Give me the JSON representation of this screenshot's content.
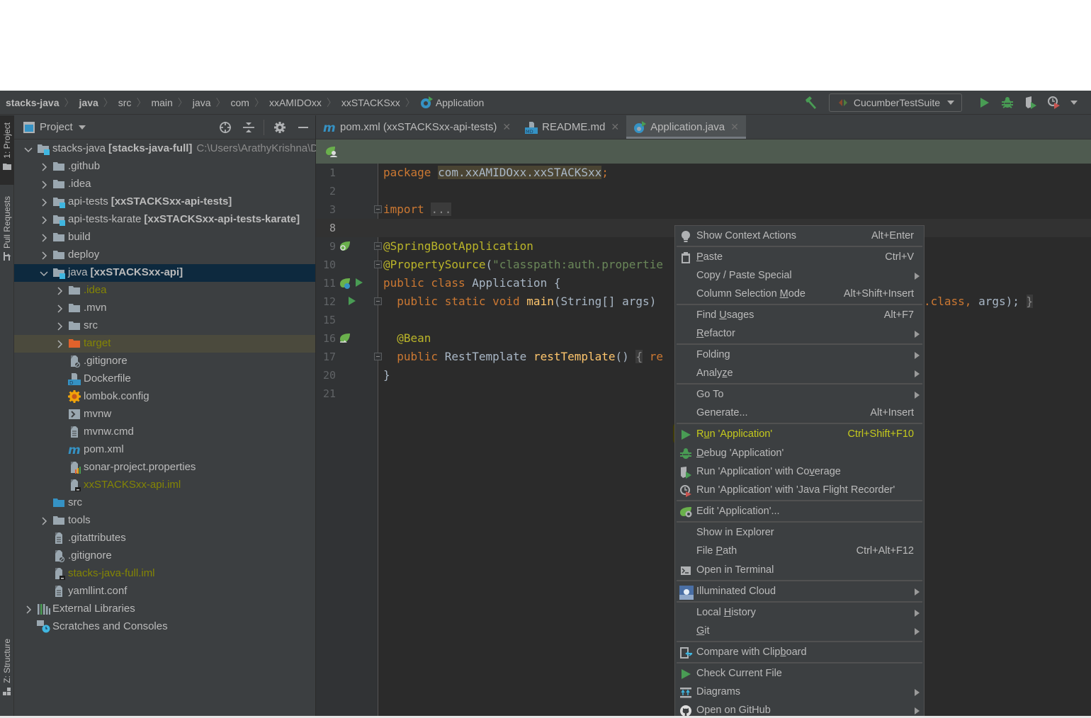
{
  "breadcrumb": {
    "items": [
      {
        "label": "stacks-java",
        "bold": true
      },
      {
        "label": "java",
        "bold": true
      },
      {
        "label": "src",
        "bold": false
      },
      {
        "label": "main",
        "bold": false
      },
      {
        "label": "java",
        "bold": false
      },
      {
        "label": "com",
        "bold": false
      },
      {
        "label": "xxAMIDOxx",
        "bold": false
      },
      {
        "label": "xxSTACKSxx",
        "bold": false
      }
    ],
    "current": "Application",
    "current_icon": "spring-class-icon"
  },
  "toolbar": {
    "build_icon": "hammer-icon",
    "run_config": "CucumberTestSuite",
    "run_icon": "run-icon",
    "debug_icon": "debug-bug-icon",
    "coverage_icon": "coverage-icon",
    "profiler_icon": "profiler-icon"
  },
  "left_strip": {
    "project_tab": "1: Project",
    "pull_requests_tab": "Pull Requests",
    "structure_tab": "Z: Structure"
  },
  "project_panel": {
    "title": "Project",
    "tree": [
      {
        "label": "stacks-java",
        "bold": "[stacks-java-full]",
        "path": "C:\\Users\\ArathyKrishna\\Do",
        "depth": 0,
        "expanded": true,
        "icon": "module-folder"
      },
      {
        "label": ".github",
        "depth": 1,
        "expanded": false,
        "icon": "folder"
      },
      {
        "label": ".idea",
        "depth": 1,
        "expanded": false,
        "icon": "folder"
      },
      {
        "label": "api-tests",
        "bold": "[xxSTACKSxx-api-tests]",
        "depth": 1,
        "expanded": false,
        "icon": "module-folder"
      },
      {
        "label": "api-tests-karate",
        "bold": "[xxSTACKSxx-api-tests-karate]",
        "depth": 1,
        "expanded": false,
        "icon": "module-folder"
      },
      {
        "label": "build",
        "depth": 1,
        "expanded": false,
        "icon": "folder"
      },
      {
        "label": "deploy",
        "depth": 1,
        "expanded": false,
        "icon": "folder"
      },
      {
        "label": "java",
        "bold": "[xxSTACKSxx-api]",
        "depth": 1,
        "expanded": true,
        "icon": "module-folder",
        "selected": true
      },
      {
        "label": ".idea",
        "depth": 2,
        "expanded": false,
        "icon": "folder",
        "ignored": true
      },
      {
        "label": ".mvn",
        "depth": 2,
        "expanded": false,
        "icon": "folder"
      },
      {
        "label": "src",
        "depth": 2,
        "expanded": false,
        "icon": "folder"
      },
      {
        "label": "target",
        "depth": 2,
        "expanded": false,
        "icon": "excluded-folder",
        "ignored": true,
        "target": true
      },
      {
        "label": ".gitignore",
        "depth": 2,
        "icon": "gitignore-file"
      },
      {
        "label": "Dockerfile",
        "depth": 2,
        "icon": "docker-file"
      },
      {
        "label": "lombok.config",
        "depth": 2,
        "icon": "lombok-config"
      },
      {
        "label": "mvnw",
        "depth": 2,
        "icon": "shell-script"
      },
      {
        "label": "mvnw.cmd",
        "depth": 2,
        "icon": "text-file"
      },
      {
        "label": "pom.xml",
        "depth": 2,
        "icon": "maven-file"
      },
      {
        "label": "sonar-project.properties",
        "depth": 2,
        "icon": "properties-file"
      },
      {
        "label": "xxSTACKSxx-api.iml",
        "depth": 2,
        "icon": "iml-file",
        "ignored": true
      },
      {
        "label": "src",
        "depth": 1,
        "icon": "source-folder"
      },
      {
        "label": "tools",
        "depth": 1,
        "expanded": false,
        "icon": "folder"
      },
      {
        "label": ".gitattributes",
        "depth": 1,
        "icon": "text-file"
      },
      {
        "label": ".gitignore",
        "depth": 1,
        "icon": "gitignore-file"
      },
      {
        "label": "stacks-java-full.iml",
        "depth": 1,
        "icon": "iml-file",
        "ignored": true
      },
      {
        "label": "yamllint.conf",
        "depth": 1,
        "icon": "text-file"
      },
      {
        "label": "External Libraries",
        "depth": 0,
        "expanded": false,
        "icon": "libraries"
      },
      {
        "label": "Scratches and Consoles",
        "depth": 0,
        "icon": "scratches"
      }
    ]
  },
  "editor": {
    "tabs": [
      {
        "label": "pom.xml (xxSTACKSxx-api-tests)",
        "icon": "maven-file",
        "active": false
      },
      {
        "label": "README.md",
        "icon": "markdown-file",
        "active": false
      },
      {
        "label": "Application.java",
        "icon": "spring-class-icon",
        "active": true
      }
    ],
    "lines": [
      {
        "n": "1"
      },
      {
        "n": "2"
      },
      {
        "n": "3"
      },
      {
        "n": "8",
        "current": true
      },
      {
        "n": "9"
      },
      {
        "n": "10"
      },
      {
        "n": "11"
      },
      {
        "n": "12"
      },
      {
        "n": "15"
      },
      {
        "n": "16"
      },
      {
        "n": "17"
      },
      {
        "n": "20"
      },
      {
        "n": "21"
      }
    ],
    "code": {
      "l1_kw": "package",
      "l1_pkg": "com.xxAMIDOxx.xxSTACKSxx",
      "l1_semi": ";",
      "l3_kw": "import",
      "l3_fold": "...",
      "l9_ann": "@SpringBootApplication",
      "l10_ann": "@PropertySource",
      "l10_paren": "(",
      "l10_str": "\"classpath:auth.propertie",
      "l11_kw": "public class",
      "l11_name": "Application {",
      "l12_kw": "public static void",
      "l12_fn": "main",
      "l12_rest": "(String[] args)",
      "l12_tail_kw": ".class,",
      "l12_tail_rest": "args);",
      "l12_tail_brace": "}",
      "l16_ann": "@Bean",
      "l17_kw": "public",
      "l17_type": "RestTemplate",
      "l17_fn": "restTemplate",
      "l17_paren": "()",
      "l17_brace": "{",
      "l17_tail": "re",
      "l20": "}"
    }
  },
  "context_menu": {
    "items": [
      {
        "label": "Show Context Actions",
        "shortcut": "Alt+Enter",
        "icon": "lightbulb-icon"
      },
      {
        "label": "Paste",
        "mnemonic": "P",
        "shortcut": "Ctrl+V",
        "icon": "clipboard-icon"
      },
      {
        "label": "Copy / Paste Special",
        "submenu": true
      },
      {
        "label": "Column Selection Mode",
        "mnemonic": "M",
        "shortcut": "Alt+Shift+Insert"
      },
      {
        "label": "Find Usages",
        "mnemonic": "U",
        "shortcut": "Alt+F7"
      },
      {
        "label": "Refactor",
        "mnemonic": "R",
        "submenu": true
      },
      {
        "label": "Folding",
        "submenu": true
      },
      {
        "label": "Analyze",
        "mnemonic": "z",
        "submenu": true
      },
      {
        "label": "Go To",
        "submenu": true
      },
      {
        "label": "Generate...",
        "shortcut": "Alt+Insert"
      },
      {
        "label": "Run 'Application'",
        "mnemonic": "u",
        "shortcut": "Ctrl+Shift+F10",
        "icon": "run-icon",
        "highlighted": true
      },
      {
        "label": "Debug 'Application'",
        "mnemonic": "D",
        "icon": "debug-bug-icon"
      },
      {
        "label": "Run 'Application' with Coverage",
        "mnemonic": "v",
        "icon": "coverage-icon"
      },
      {
        "label": "Run 'Application' with 'Java Flight Recorder'",
        "icon": "profiler-icon"
      },
      {
        "label": "Edit 'Application'...",
        "icon": "spring-config-icon"
      },
      {
        "label": "Show in Explorer"
      },
      {
        "label": "File Path",
        "mnemonic": "P",
        "shortcut": "Ctrl+Alt+F12"
      },
      {
        "label": "Open in Terminal",
        "icon": "terminal-icon"
      },
      {
        "label": "Illuminated Cloud",
        "icon": "illuminated-cloud-icon",
        "submenu": true
      },
      {
        "label": "Local History",
        "mnemonic": "H",
        "submenu": true
      },
      {
        "label": "Git",
        "mnemonic": "G",
        "submenu": true
      },
      {
        "label": "Compare with Clipboard",
        "mnemonic": "b",
        "icon": "compare-clipboard-icon"
      },
      {
        "label": "Check Current File",
        "icon": "run-icon"
      },
      {
        "label": "Diagrams",
        "icon": "diagrams-icon",
        "submenu": true
      },
      {
        "label": "Open on GitHub",
        "icon": "github-icon",
        "submenu": true
      }
    ]
  },
  "colors": {
    "highlight_marker": "#3f3c08",
    "highlight_text": "#c6cb1c",
    "run_green": "#499c54",
    "selected_row": "#0d293e",
    "keyword": "#cc7832",
    "annotation": "#bbb529",
    "string": "#6a8759"
  }
}
